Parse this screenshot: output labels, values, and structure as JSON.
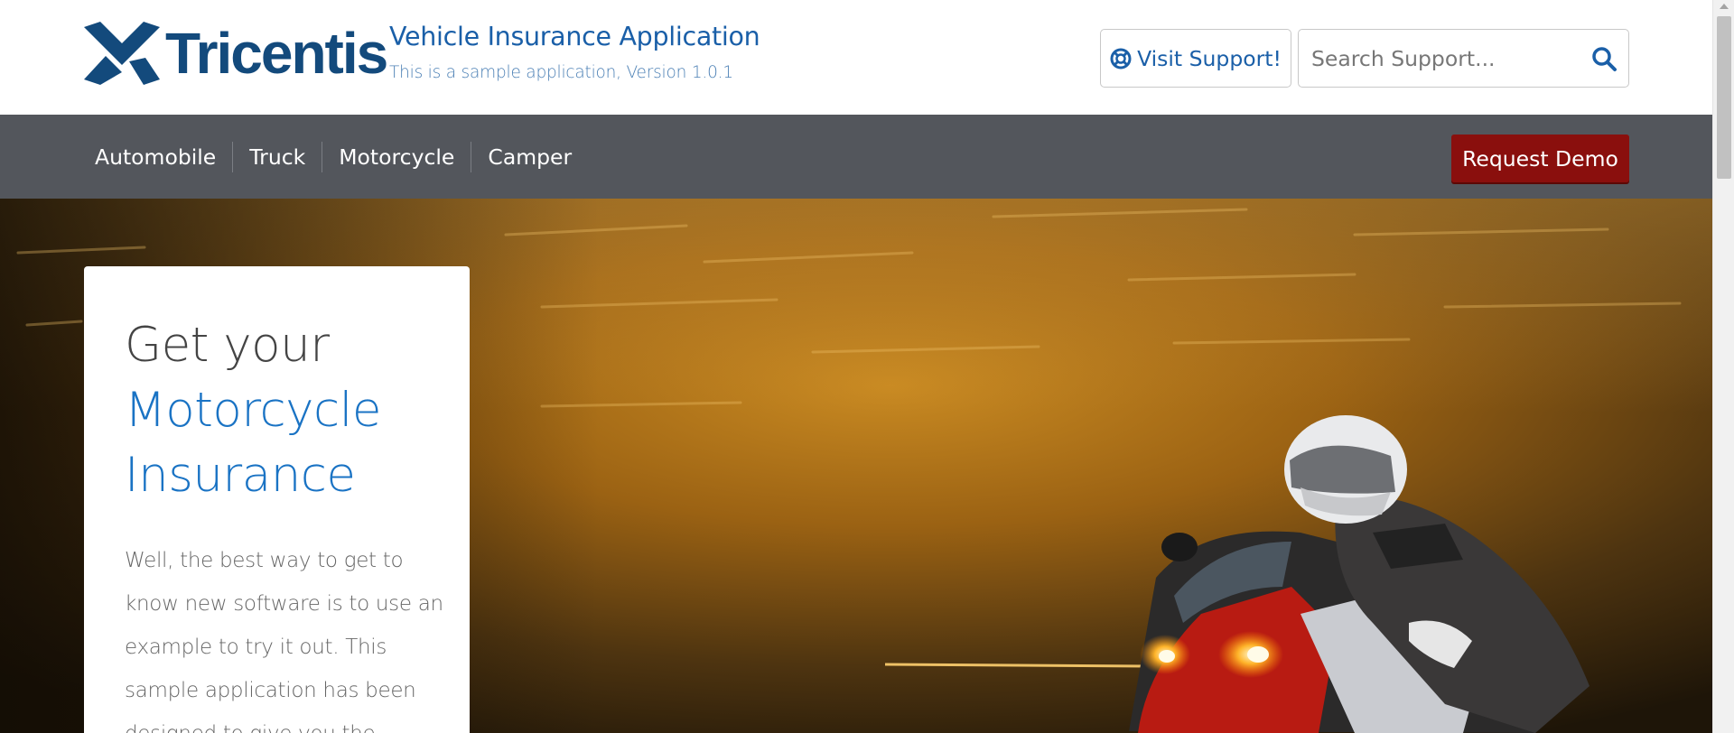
{
  "header": {
    "logo_text": "Tricentis",
    "app_title": "Vehicle Insurance Application",
    "app_subtitle": "This is a sample application, Version 1.0.1",
    "support_button_label": "Visit Support!",
    "search_placeholder": "Search Support...",
    "icons": {
      "support": "lifebuoy-icon",
      "search": "search-icon"
    }
  },
  "nav": {
    "items": [
      {
        "label": "Automobile"
      },
      {
        "label": "Truck"
      },
      {
        "label": "Motorcycle"
      },
      {
        "label": "Camper"
      }
    ],
    "demo_button_label": "Request Demo"
  },
  "hero": {
    "title_line1": "Get your",
    "title_line2": "Motorcycle",
    "title_line3": "Insurance",
    "body_text": "Well, the best way to get to know new software is to use an example to try it out. This sample application has been designed to give you the"
  },
  "colors": {
    "brand_blue": "#134a7c",
    "link_blue": "#1a5fa8",
    "nav_bg": "#53565c",
    "demo_red": "#8a0f0d"
  }
}
